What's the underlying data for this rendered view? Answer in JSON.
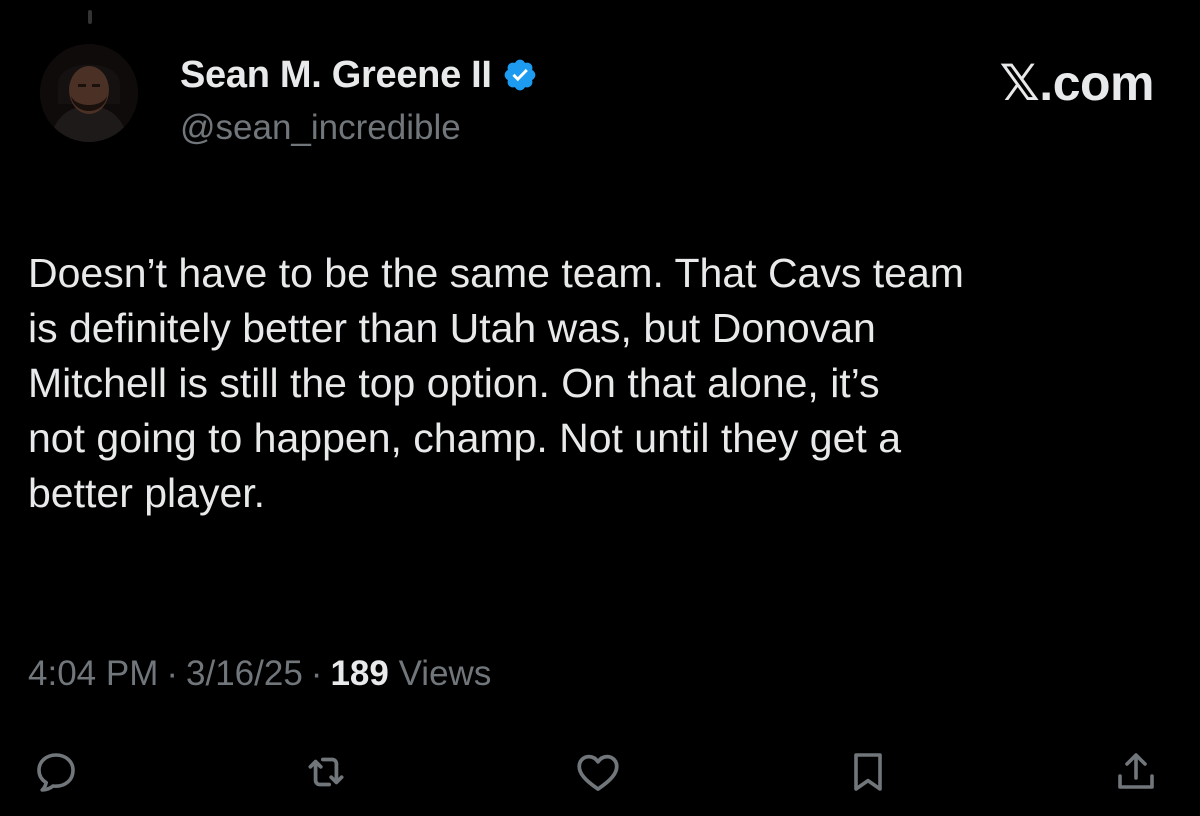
{
  "author": {
    "display_name": "Sean M. Greene II",
    "handle": "@sean_incredible",
    "verified": true
  },
  "brand": "𝕏.com",
  "tweet": {
    "text_lines": [
      "Doesn’t have to be the same team. That Cavs team",
      "is definitely better than Utah was, but Donovan",
      "Mitchell is still the top option. On that alone, it’s",
      "not going to happen, champ. Not until they get a",
      "better player."
    ]
  },
  "meta": {
    "time": "4:04 PM",
    "date": "3/16/25",
    "views_count": "189",
    "views_label": "Views",
    "separator": "·"
  },
  "actions": {
    "reply_icon": "reply-icon",
    "retweet_icon": "retweet-icon",
    "like_icon": "heart-icon",
    "bookmark_icon": "bookmark-icon",
    "share_icon": "share-icon"
  },
  "colors": {
    "background": "#000000",
    "primary_text": "#e7e9ea",
    "secondary_text": "#71767b",
    "verified_blue": "#1d9bf0"
  }
}
